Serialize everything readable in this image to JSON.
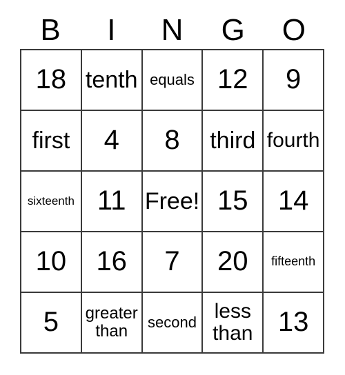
{
  "card": {
    "headers": [
      "B",
      "I",
      "N",
      "G",
      "O"
    ],
    "free_space_label": "Free!",
    "rows": [
      [
        {
          "text": "18",
          "size": "xl"
        },
        {
          "text": "tenth",
          "size": "lg"
        },
        {
          "text": "equals",
          "size": "xs"
        },
        {
          "text": "12",
          "size": "xl"
        },
        {
          "text": "9",
          "size": "xl"
        }
      ],
      [
        {
          "text": "first",
          "size": "lg"
        },
        {
          "text": "4",
          "size": "xl"
        },
        {
          "text": "8",
          "size": "xl"
        },
        {
          "text": "third",
          "size": "lg"
        },
        {
          "text": "fourth",
          "size": "md"
        }
      ],
      [
        {
          "text": "sixteenth",
          "size": "tiny"
        },
        {
          "text": "11",
          "size": "xl"
        },
        {
          "text": "Free!",
          "size": "lg"
        },
        {
          "text": "15",
          "size": "xl"
        },
        {
          "text": "14",
          "size": "xl"
        }
      ],
      [
        {
          "text": "10",
          "size": "xl"
        },
        {
          "text": "16",
          "size": "xl"
        },
        {
          "text": "7",
          "size": "xl"
        },
        {
          "text": "20",
          "size": "xl"
        },
        {
          "text": "fifteenth",
          "size": "xxs"
        }
      ],
      [
        {
          "text": "5",
          "size": "xl"
        },
        {
          "text": "greater than",
          "size": "sm"
        },
        {
          "text": "second",
          "size": "xs"
        },
        {
          "text": "less than",
          "size": "md"
        },
        {
          "text": "13",
          "size": "xl"
        }
      ]
    ],
    "colors": {
      "border": "#3a3a3a",
      "background": "#ffffff",
      "text": "#000000"
    }
  }
}
